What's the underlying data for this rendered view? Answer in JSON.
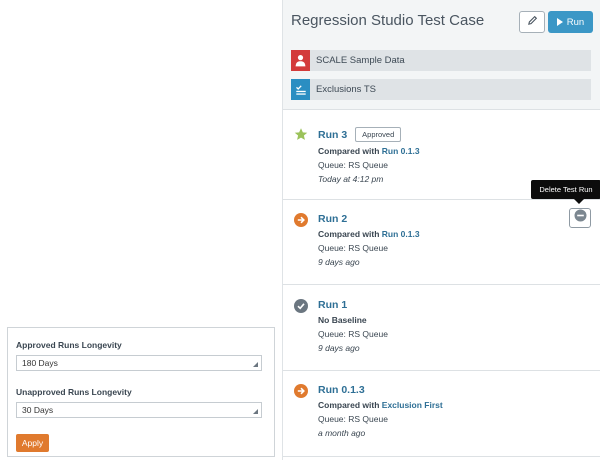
{
  "settings": {
    "approved_label": "Approved Runs Longevity",
    "approved_value": "180 Days",
    "unapproved_label": "Unapproved Runs Longevity",
    "unapproved_value": "30 Days",
    "apply_label": "Apply"
  },
  "case": {
    "title": "Regression Studio Test Case",
    "run_label": "Run",
    "sources": [
      {
        "label": "SCALE Sample Data",
        "icon": "person-icon",
        "color": "#d33b3b"
      },
      {
        "label": "Exclusions TS",
        "icon": "list-check-icon",
        "color": "#2b8ec2"
      }
    ]
  },
  "runs": [
    {
      "name": "Run 3",
      "badge": "Approved",
      "compared_prefix": "Compared with",
      "compared_link": "Run 0.1.3",
      "queue": "Queue: RS Queue",
      "when": "Today at 4:12 pm",
      "icon": "star-icon",
      "icon_color": "#9bc25a"
    },
    {
      "name": "Run 2",
      "compared_prefix": "Compared with",
      "compared_link": "Run 0.1.3",
      "queue": "Queue: RS Queue",
      "when": "9 days ago",
      "icon": "arrow-right-circle-icon",
      "icon_color": "#e07a2e"
    },
    {
      "name": "Run 1",
      "compared_prefix": "No Baseline",
      "compared_link": "",
      "queue": "Queue: RS Queue",
      "when": "9 days ago",
      "icon": "check-circle-icon",
      "icon_color": "#6b7680"
    },
    {
      "name": "Run 0.1.3",
      "compared_prefix": "Compared with",
      "compared_link": "Exclusion First",
      "queue": "Queue: RS Queue",
      "when": "a month ago",
      "icon": "arrow-right-circle-icon",
      "icon_color": "#e07a2e"
    }
  ],
  "tooltip": "Delete Test Run"
}
